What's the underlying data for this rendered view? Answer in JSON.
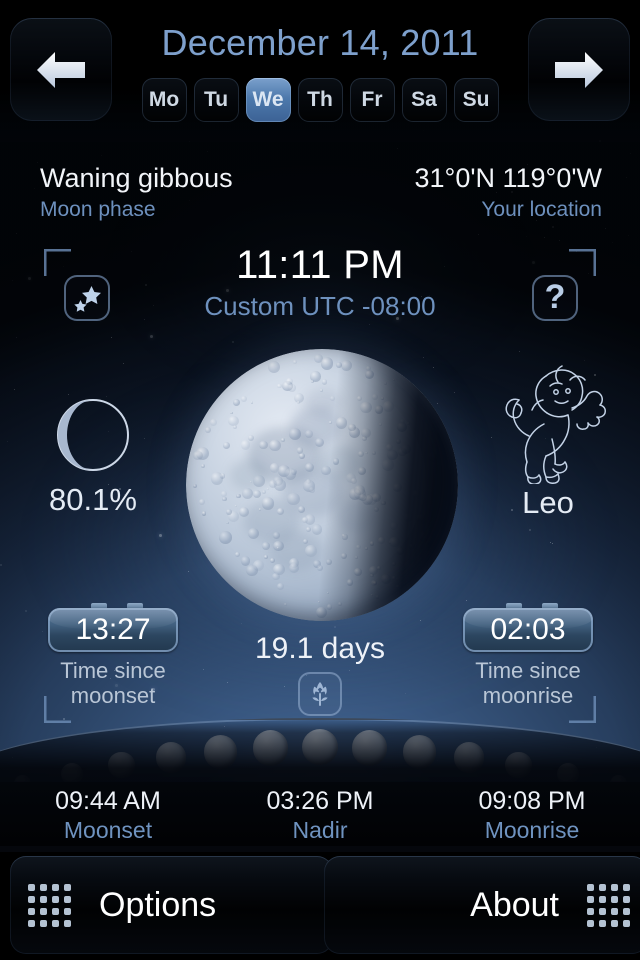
{
  "header": {
    "date": "December 14, 2011",
    "prev_label": "left-arrow",
    "next_label": "right-arrow",
    "weekdays": [
      {
        "label": "Mo",
        "active": false
      },
      {
        "label": "Tu",
        "active": false
      },
      {
        "label": "We",
        "active": true
      },
      {
        "label": "Th",
        "active": false
      },
      {
        "label": "Fr",
        "active": false
      },
      {
        "label": "Sa",
        "active": false
      },
      {
        "label": "Su",
        "active": false
      }
    ]
  },
  "info": {
    "phase_value": "Waning gibbous",
    "phase_label": "Moon phase",
    "location_value": "31°0'N 119°0'W",
    "location_label": "Your location"
  },
  "clock": {
    "time": "11:11 PM",
    "timezone": "Custom UTC -08:00"
  },
  "buttons": {
    "favorites": "stars-icon",
    "help": "?",
    "season": "flower-icon"
  },
  "moon": {
    "illumination": "80.1%",
    "age": "19.1 days",
    "zodiac": "Leo"
  },
  "timers": {
    "moonset": {
      "value": "13:27",
      "caption_line1": "Time since",
      "caption_line2": "moonset"
    },
    "moonrise": {
      "value": "02:03",
      "caption_line1": "Time since",
      "caption_line2": "moonrise"
    }
  },
  "events": [
    {
      "time": "09:44 AM",
      "label": "Moonset"
    },
    {
      "time": "03:26 PM",
      "label": "Nadir"
    },
    {
      "time": "09:08 PM",
      "label": "Moonrise"
    }
  ],
  "footer": {
    "options": "Options",
    "about": "About"
  },
  "colors": {
    "accent_blue": "#7ea0cc",
    "label_blue": "#6d90bd",
    "text_white": "#f2f5f9",
    "chip_active": "#4d79ac"
  }
}
